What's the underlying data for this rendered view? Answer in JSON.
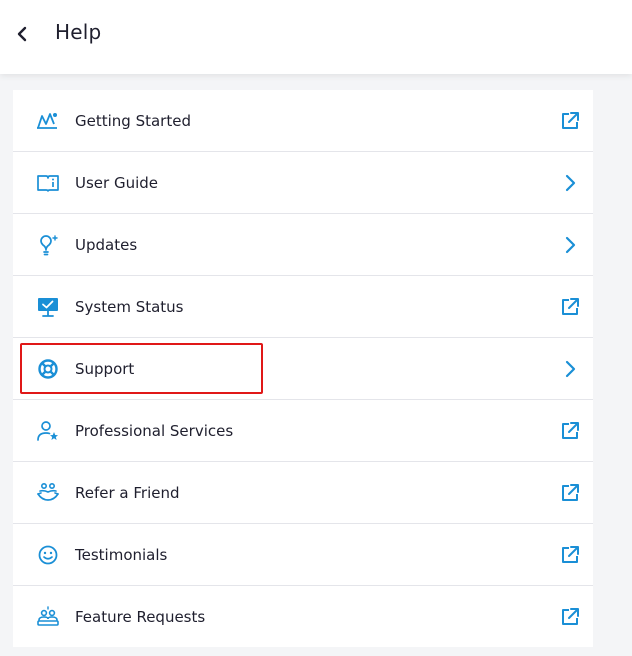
{
  "header": {
    "title": "Help",
    "back_icon": "chevron-left-icon"
  },
  "colors": {
    "accent": "#1a8fd6",
    "highlight": "#e01818",
    "text": "#1f1f2e"
  },
  "items": [
    {
      "label": "Getting Started",
      "icon": "rocket-launch-icon",
      "action": "external-link-icon"
    },
    {
      "label": "User Guide",
      "icon": "book-info-icon",
      "action": "chevron-right-icon"
    },
    {
      "label": "Updates",
      "icon": "lightbulb-icon",
      "action": "chevron-right-icon"
    },
    {
      "label": "System Status",
      "icon": "monitor-check-icon",
      "action": "external-link-icon"
    },
    {
      "label": "Support",
      "icon": "lifebuoy-icon",
      "action": "chevron-right-icon",
      "highlighted": true
    },
    {
      "label": "Professional Services",
      "icon": "user-star-icon",
      "action": "external-link-icon"
    },
    {
      "label": "Refer a Friend",
      "icon": "people-hands-icon",
      "action": "external-link-icon"
    },
    {
      "label": "Testimonials",
      "icon": "smiley-icon",
      "action": "external-link-icon"
    },
    {
      "label": "Feature Requests",
      "icon": "group-idea-icon",
      "action": "external-link-icon"
    }
  ]
}
